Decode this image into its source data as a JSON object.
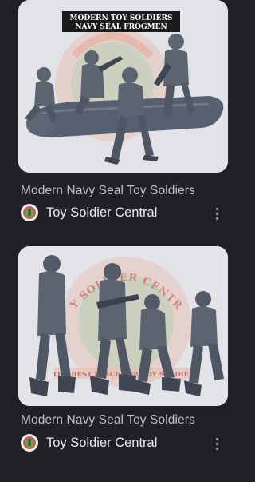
{
  "results": [
    {
      "image_banner_line1": "MODERN TOY SOLDIERS",
      "image_banner_line2": "NAVY SEAL FROGMEN",
      "title": "Modern Navy Seal Toy Soldiers",
      "source": "Toy Soldier Central",
      "favicon_icon": "toy-soldier-central-logo-icon",
      "more_icon": "more-vert-icon"
    },
    {
      "image_arc_text": "TOY SOLDIER CENTRAL",
      "image_bottom_text": "THE BEST PLACE FOR TOY SOLDIERS",
      "title": "Modern Navy Seal Toy Soldiers",
      "source": "Toy Soldier Central",
      "favicon_icon": "toy-soldier-central-logo-icon",
      "more_icon": "more-vert-icon"
    }
  ],
  "colors": {
    "background": "#202124",
    "title_text": "#bdc1c6",
    "source_text": "#e8eaed",
    "figure_gray": "#5c6470"
  }
}
